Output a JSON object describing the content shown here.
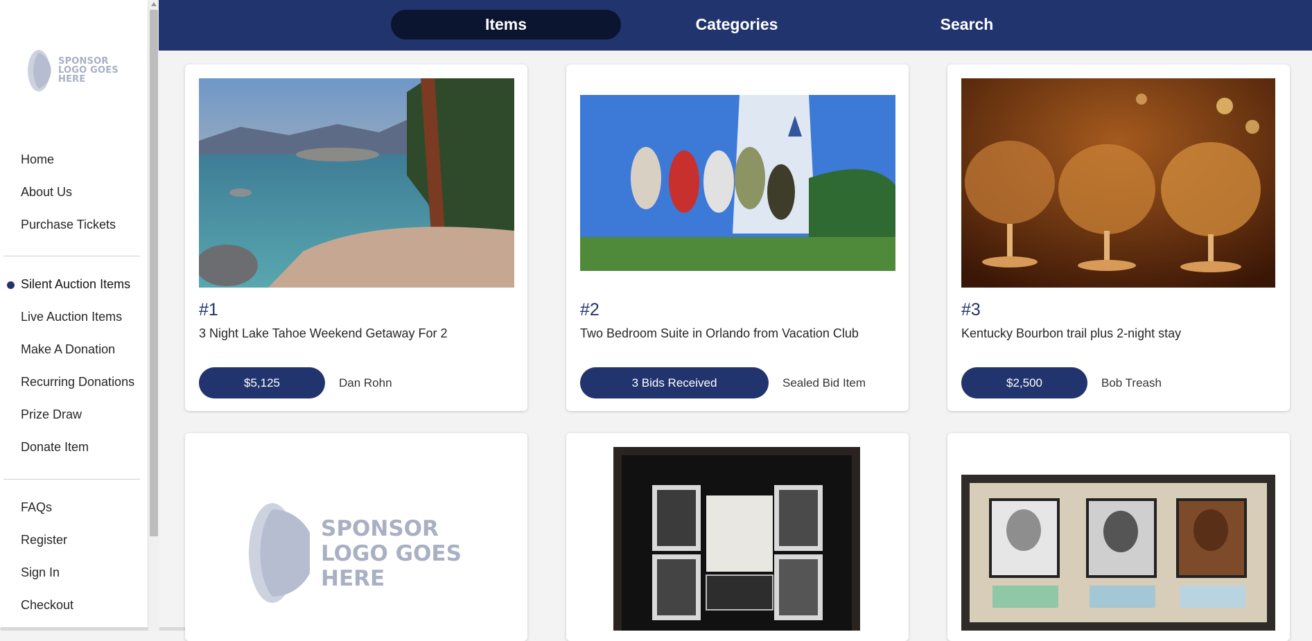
{
  "sponsor_logo": {
    "lines": [
      "SPONSOR",
      "LOGO GOES",
      "HERE"
    ]
  },
  "sidebar": {
    "nav_group_1": [
      {
        "label": "Home"
      },
      {
        "label": "About Us"
      },
      {
        "label": "Purchase Tickets"
      }
    ],
    "nav_group_2": [
      {
        "label": "Silent Auction Items",
        "active": true
      },
      {
        "label": "Live Auction Items"
      },
      {
        "label": "Make A Donation"
      },
      {
        "label": "Recurring Donations"
      },
      {
        "label": "Prize Draw"
      },
      {
        "label": "Donate Item"
      }
    ],
    "nav_group_3": [
      {
        "label": "FAQs"
      },
      {
        "label": "Register"
      },
      {
        "label": "Sign In"
      },
      {
        "label": "Checkout"
      }
    ]
  },
  "topbar": {
    "tabs": [
      {
        "label": "Items",
        "active": true
      },
      {
        "label": "Categories"
      },
      {
        "label": "Search"
      }
    ]
  },
  "items": [
    {
      "number": "#1",
      "title": "3 Night Lake Tahoe Weekend Getaway For 2",
      "bid_label": "$5,125",
      "bidder": "Dan Rohn",
      "image": "lake-tahoe-photo"
    },
    {
      "number": "#2",
      "title": "Two Bedroom Suite in Orlando from Vacation Club",
      "bid_label": "3 Bids Received",
      "bidder": "Sealed Bid Item",
      "image": "family-castle-photo"
    },
    {
      "number": "#3",
      "title": "Kentucky Bourbon trail plus 2-night stay",
      "bid_label": "$2,500",
      "bidder": "Bob Treash",
      "image": "bourbon-glasses-photo"
    },
    {
      "image": "sponsor-logo-placeholder"
    },
    {
      "image": "lincoln-framed-collage"
    },
    {
      "image": "sports-legends-framed-collage"
    }
  ],
  "colors": {
    "brand_navy": "#22346e",
    "active_tab": "#0c1530",
    "page_bg": "#f3f3f3"
  }
}
